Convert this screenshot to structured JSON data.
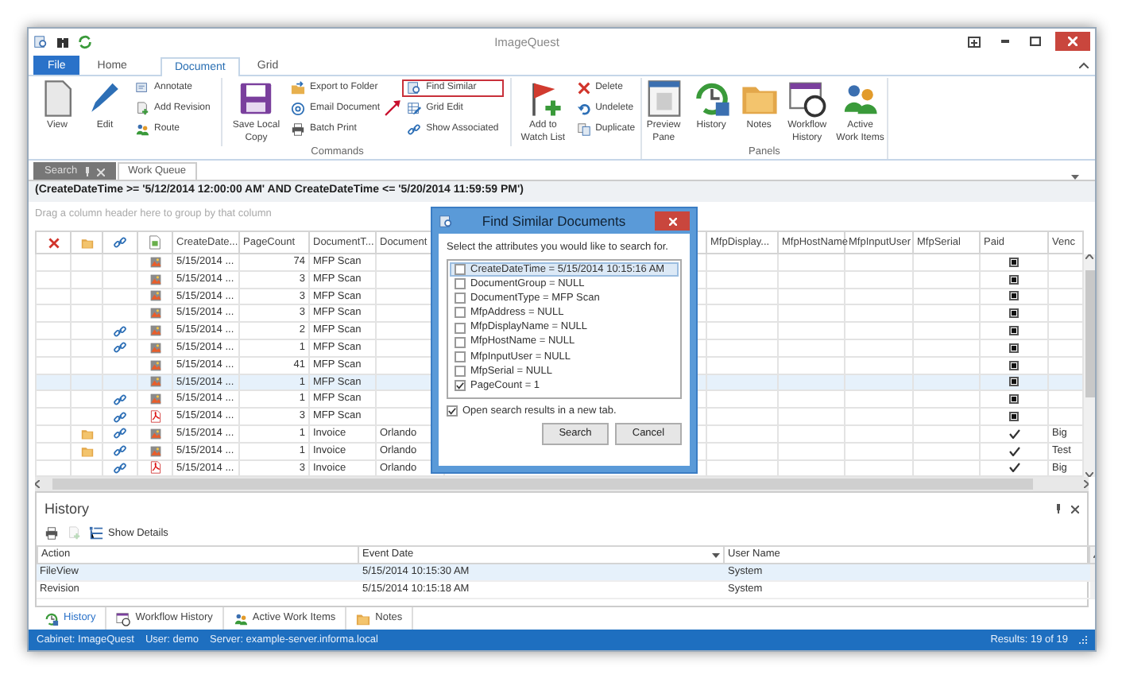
{
  "window": {
    "title": "ImageQuest"
  },
  "ribbon": {
    "tabs": [
      {
        "label": "File",
        "selected": false,
        "kind": "file"
      },
      {
        "label": "Home",
        "selected": false,
        "kind": "tab"
      },
      {
        "label": "Document",
        "selected": true,
        "kind": "tab"
      },
      {
        "label": "Grid",
        "selected": false,
        "kind": "tab"
      }
    ],
    "groups": [
      {
        "label": "Commands",
        "items": [
          {
            "kind": "large",
            "label": "View"
          },
          {
            "kind": "large",
            "label": "Edit"
          },
          {
            "kind": "stack",
            "items": [
              {
                "label": "Annotate",
                "highlighted": false
              },
              {
                "label": "Add Revision",
                "highlighted": false
              },
              {
                "label": "Route",
                "highlighted": false
              }
            ]
          },
          {
            "kind": "separator"
          },
          {
            "kind": "large",
            "label": "Save Local\nCopy"
          },
          {
            "kind": "stack",
            "items": [
              {
                "label": "Export to Folder",
                "highlighted": false
              },
              {
                "label": "Email Document",
                "highlighted": false
              },
              {
                "label": "Batch Print",
                "highlighted": false
              }
            ]
          },
          {
            "kind": "stack",
            "items": [
              {
                "label": "Find Similar",
                "highlighted": true
              },
              {
                "label": "Grid Edit",
                "highlighted": false
              },
              {
                "label": "Show Associated",
                "highlighted": false
              }
            ]
          },
          {
            "kind": "separator"
          },
          {
            "kind": "large",
            "label": "Add to\nWatch List"
          },
          {
            "kind": "stack",
            "items": [
              {
                "label": "Delete",
                "highlighted": false
              },
              {
                "label": "Undelete",
                "highlighted": false
              },
              {
                "label": "Duplicate",
                "highlighted": false
              }
            ]
          }
        ]
      },
      {
        "label": "Panels",
        "items": [
          {
            "kind": "large",
            "label": "Preview\nPane"
          },
          {
            "kind": "large",
            "label": "History"
          },
          {
            "kind": "large",
            "label": "Notes"
          },
          {
            "kind": "large",
            "label": "Workflow\nHistory"
          },
          {
            "kind": "large",
            "label": "Active\nWork Items"
          }
        ]
      }
    ]
  },
  "document_tabs": [
    {
      "label": "Search",
      "selected": true
    },
    {
      "label": "Work Queue",
      "selected": false
    }
  ],
  "filter": "(CreateDateTime >= '5/12/2014 12:00:00 AM' AND CreateDateTime <= '5/20/2014 11:59:59 PM')",
  "group_hint": "Drag a column header here to group by that column",
  "grid": {
    "columns": [
      {
        "kind": "delete"
      },
      {
        "kind": "note"
      },
      {
        "kind": "link"
      },
      {
        "kind": "file"
      },
      {
        "kind": "text",
        "label": "CreateDate..."
      },
      {
        "kind": "text",
        "label": "PageCount"
      },
      {
        "kind": "text",
        "label": "DocumentT..."
      },
      {
        "kind": "text",
        "label": "Document"
      },
      {
        "kind": "hidden"
      },
      {
        "kind": "text",
        "label": "MfpDisplay..."
      },
      {
        "kind": "text",
        "label": "MfpHostName"
      },
      {
        "kind": "text",
        "label": "MfpInputUser"
      },
      {
        "kind": "text",
        "label": "MfpSerial"
      },
      {
        "kind": "text",
        "label": "Paid"
      },
      {
        "kind": "text",
        "label": "Venc"
      }
    ],
    "rows": [
      {
        "note": false,
        "linked": false,
        "kind": "image",
        "create_date": "5/15/2014 ...",
        "page_count": "74",
        "document_type": "MFP Scan",
        "paid": false,
        "selected": false
      },
      {
        "note": false,
        "linked": false,
        "kind": "image",
        "create_date": "5/15/2014 ...",
        "page_count": "3",
        "document_type": "MFP Scan",
        "paid": false,
        "selected": false
      },
      {
        "note": false,
        "linked": false,
        "kind": "image",
        "create_date": "5/15/2014 ...",
        "page_count": "3",
        "document_type": "MFP Scan",
        "paid": false,
        "selected": false
      },
      {
        "note": false,
        "linked": false,
        "kind": "image",
        "create_date": "5/15/2014 ...",
        "page_count": "3",
        "document_type": "MFP Scan",
        "paid": false,
        "selected": false
      },
      {
        "note": false,
        "linked": true,
        "kind": "image",
        "create_date": "5/15/2014 ...",
        "page_count": "2",
        "document_type": "MFP Scan",
        "paid": false,
        "selected": false
      },
      {
        "note": false,
        "linked": true,
        "kind": "image",
        "create_date": "5/15/2014 ...",
        "page_count": "1",
        "document_type": "MFP Scan",
        "paid": false,
        "selected": false
      },
      {
        "note": false,
        "linked": false,
        "kind": "image",
        "create_date": "5/15/2014 ...",
        "page_count": "41",
        "document_type": "MFP Scan",
        "paid": false,
        "selected": false
      },
      {
        "note": false,
        "linked": false,
        "kind": "image",
        "create_date": "5/15/2014 ...",
        "page_count": "1",
        "document_type": "MFP Scan",
        "paid": false,
        "selected": true
      },
      {
        "note": false,
        "linked": true,
        "kind": "image",
        "create_date": "5/15/2014 ...",
        "page_count": "1",
        "document_type": "MFP Scan",
        "paid": false,
        "selected": false
      },
      {
        "note": false,
        "linked": true,
        "kind": "pdf",
        "create_date": "5/15/2014 ...",
        "page_count": "3",
        "document_type": "MFP Scan",
        "paid": false,
        "selected": false
      },
      {
        "note": true,
        "linked": true,
        "kind": "image",
        "create_date": "5/15/2014 ...",
        "page_count": "1",
        "document_type": "Invoice",
        "document_group": "Orlando",
        "paid": true,
        "vendor": "Big",
        "selected": false
      },
      {
        "note": true,
        "linked": true,
        "kind": "image",
        "create_date": "5/15/2014 ...",
        "page_count": "1",
        "document_type": "Invoice",
        "document_group": "Orlando",
        "paid": true,
        "vendor": "Test",
        "selected": false
      },
      {
        "note": false,
        "linked": true,
        "kind": "pdf",
        "create_date": "5/15/2014 ...",
        "page_count": "3",
        "document_type": "Invoice",
        "document_group": "Orlando",
        "paid": true,
        "vendor": "Big",
        "selected": false
      }
    ]
  },
  "dialog": {
    "title": "Find Similar Documents",
    "prompt": "Select the attributes you would like to search for.",
    "attributes": [
      {
        "label": "CreateDateTime = 5/15/2014 10:15:16 AM",
        "checked": false,
        "selected": true
      },
      {
        "label": "DocumentGroup = NULL",
        "checked": false,
        "selected": false
      },
      {
        "label": "DocumentType = MFP Scan",
        "checked": false,
        "selected": false
      },
      {
        "label": "MfpAddress = NULL",
        "checked": false,
        "selected": false
      },
      {
        "label": "MfpDisplayName = NULL",
        "checked": false,
        "selected": false
      },
      {
        "label": "MfpHostName = NULL",
        "checked": false,
        "selected": false
      },
      {
        "label": "MfpInputUser = NULL",
        "checked": false,
        "selected": false
      },
      {
        "label": "MfpSerial = NULL",
        "checked": false,
        "selected": false
      },
      {
        "label": "PageCount = 1",
        "checked": true,
        "selected": false
      }
    ],
    "new_tab": {
      "label": "Open search results in a new tab.",
      "checked": true
    },
    "buttons": [
      "Search",
      "Cancel"
    ]
  },
  "history": {
    "title": "History",
    "toolbar": [
      {
        "kind": "print",
        "disabled": false
      },
      {
        "kind": "export",
        "disabled": true
      },
      {
        "kind": "details",
        "label": "Show Details",
        "disabled": false
      }
    ],
    "columns": [
      "Action",
      "Event Date",
      "User Name"
    ],
    "rows": [
      {
        "cells": [
          "FileView",
          "5/15/2014 10:15:30 AM",
          "System"
        ],
        "selected": true
      },
      {
        "cells": [
          "Revision",
          "5/15/2014 10:15:18 AM",
          "System"
        ],
        "selected": false
      }
    ]
  },
  "bottom_tabs": [
    {
      "label": "History",
      "selected": true
    },
    {
      "label": "Workflow History",
      "selected": false
    },
    {
      "label": "Active Work Items",
      "selected": false
    },
    {
      "label": "Notes",
      "selected": false
    }
  ],
  "status_bar": {
    "items": [
      "Cabinet: ImageQuest",
      "User: demo",
      "Server: example-server.informa.local"
    ],
    "results": "Results: 19 of 19"
  }
}
